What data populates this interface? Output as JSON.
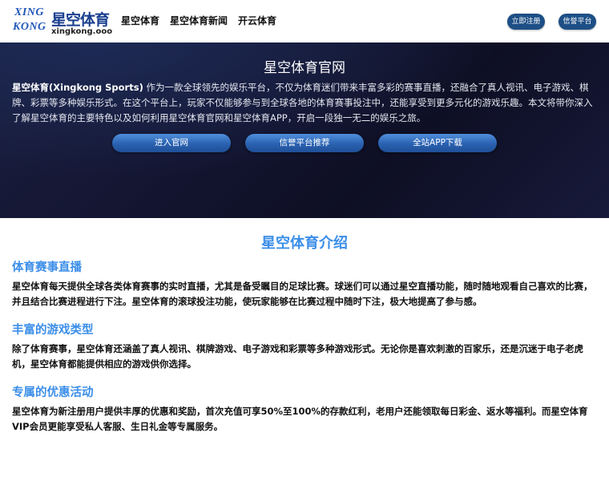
{
  "header": {
    "logo": {
      "mark_line1": "XING",
      "mark_line2": "KONG",
      "name_cn": "星空体育",
      "domain": "xingkong.ooo"
    },
    "nav": [
      "星空体育",
      "星空体育新闻",
      "开云体育"
    ],
    "register_label": "立即注册",
    "trusted_label": "信誉平台"
  },
  "hero": {
    "title": "星空体育官网",
    "intro_bold": "星空体育(Xingkong Sports)",
    "intro_rest": " 作为一款全球领先的娱乐平台，不仅为体育迷们带来丰富多彩的赛事直播，还融合了真人视讯、电子游戏、棋牌、彩票等多种娱乐形式。在这个平台上，玩家不仅能够参与到全球各地的体育赛事投注中，还能享受到更多元化的游戏乐趣。本文将带你深入了解星空体育的主要特色以及如何利用星空体育官网和星空体育APP，开启一段独一无二的娱乐之旅。",
    "buttons": [
      "进入官网",
      "信誉平台推荐",
      "全站APP下载"
    ]
  },
  "main": {
    "section_title": "星空体育介绍",
    "sections": [
      {
        "heading": "体育赛事直播",
        "text": "星空体育每天提供全球各类体育赛事的实时直播，尤其是备受瞩目的足球比赛。球迷们可以通过星空直播功能，随时随地观看自己喜欢的比赛，并且结合比赛进程进行下注。星空体育的滚球投注功能，使玩家能够在比赛过程中随时下注，极大地提高了参与感。"
      },
      {
        "heading": "丰富的游戏类型",
        "text": "除了体育赛事，星空体育还涵盖了真人视讯、棋牌游戏、电子游戏和彩票等多种游戏形式。无论你是喜欢刺激的百家乐，还是沉迷于电子老虎机，星空体育都能提供相应的游戏供你选择。"
      },
      {
        "heading": "专属的优惠活动",
        "text": "星空体育为新注册用户提供丰厚的优惠和奖励，首次充值可享50%至100%的存款红利，老用户还能领取每日彩金、返水等福利。而星空体育VIP会员更能享受私人客服、生日礼金等专属服务。"
      }
    ]
  },
  "colors": {
    "brand_blue": "#2157b7",
    "heading_blue": "#3b8ee8",
    "hero_bg": "#141632",
    "header_button": "#1d4f86"
  }
}
